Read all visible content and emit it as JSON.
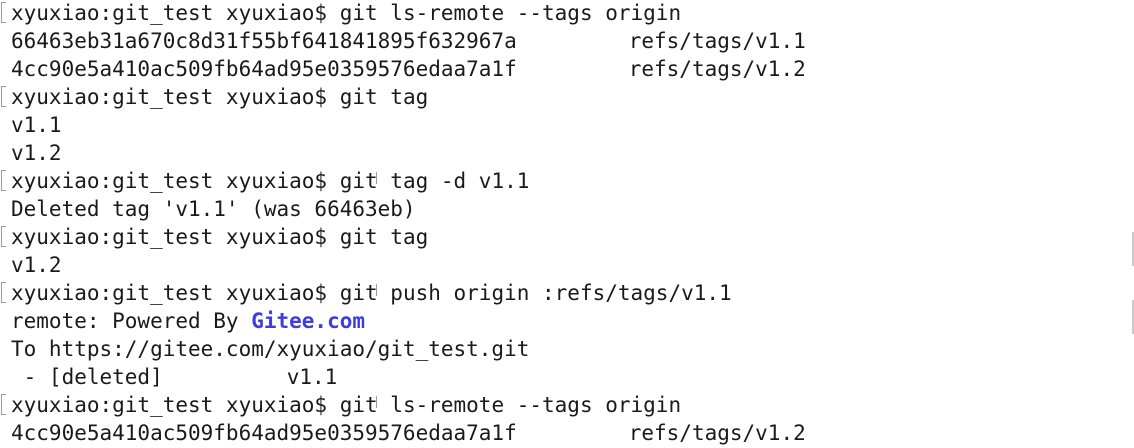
{
  "terminal": {
    "lines": [
      {
        "type": "prompt",
        "prompt": "xyuxiao:git_test xyuxiao$",
        "command": "git ls-remote --tags origin"
      },
      {
        "type": "ref",
        "hash": "66463eb31a670c8d31f55bf641841895f632967a",
        "ref": "refs/tags/v1.1"
      },
      {
        "type": "ref",
        "hash": "4cc90e5a410ac509fb64ad95e0359576edaa7a1f",
        "ref": "refs/tags/v1.2"
      },
      {
        "type": "prompt",
        "prompt": "xyuxiao:git_test xyuxiao$",
        "command": "git tag"
      },
      {
        "type": "output",
        "text": "v1.1"
      },
      {
        "type": "output",
        "text": "v1.2"
      },
      {
        "type": "prompt",
        "prompt": "xyuxiao:git_test xyuxiao$",
        "command": "git tag -d v1.1"
      },
      {
        "type": "output",
        "text": "Deleted tag 'v1.1' (was 66463eb)"
      },
      {
        "type": "prompt",
        "prompt": "xyuxiao:git_test xyuxiao$",
        "command": "git tag"
      },
      {
        "type": "output",
        "text": "v1.2"
      },
      {
        "type": "prompt",
        "prompt": "xyuxiao:git_test xyuxiao$",
        "command": "git push origin :refs/tags/v1.1"
      },
      {
        "type": "remote",
        "prefix": "remote: Powered By ",
        "link": "Gitee.com"
      },
      {
        "type": "output",
        "text": "To https://gitee.com/xyuxiao/git_test.git"
      },
      {
        "type": "deleted",
        "status": " - [deleted]",
        "ref": "v1.1"
      },
      {
        "type": "prompt",
        "prompt": "xyuxiao:git_test xyuxiao$",
        "command": "git ls-remote --tags origin"
      },
      {
        "type": "ref",
        "hash": "4cc90e5a410ac509fb64ad95e0359576edaa7a1f",
        "ref": "refs/tags/v1.2"
      }
    ]
  },
  "colors": {
    "text": "#1a1a1a",
    "link": "#3d3ddb",
    "background": "#ffffff",
    "mark": "#9a9a9a"
  }
}
